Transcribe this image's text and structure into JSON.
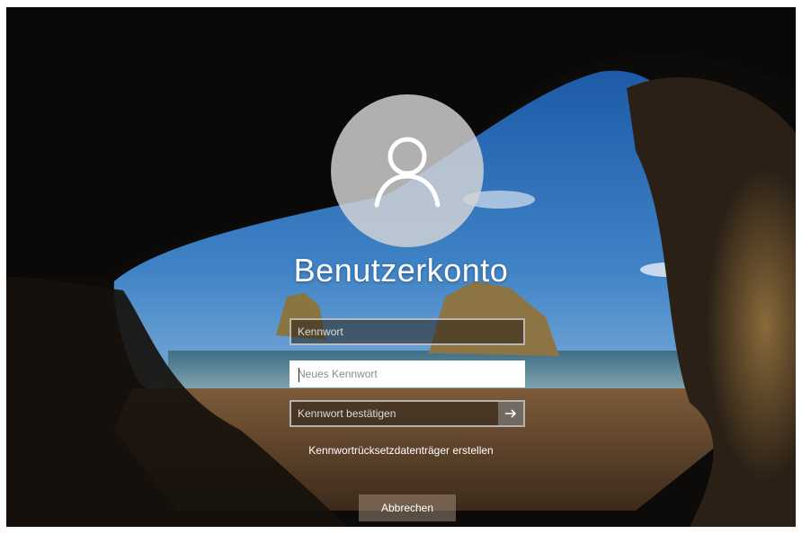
{
  "user": {
    "name": "Benutzerkonto"
  },
  "fields": {
    "old_password": {
      "placeholder": "Kennwort"
    },
    "new_password": {
      "placeholder": "Neues Kennwort"
    },
    "confirm_password": {
      "placeholder": "Kennwort bestätigen"
    }
  },
  "icons": {
    "avatar": "user-silhouette-icon",
    "submit": "arrow-right-icon"
  },
  "links": {
    "reset_disk": "Kennwortrücksetzdatenträger erstellen"
  },
  "buttons": {
    "cancel": "Abbrechen"
  },
  "colors": {
    "text": "#ffffff",
    "active_field": "#ffffff",
    "field_border": "#dcdcdc"
  }
}
